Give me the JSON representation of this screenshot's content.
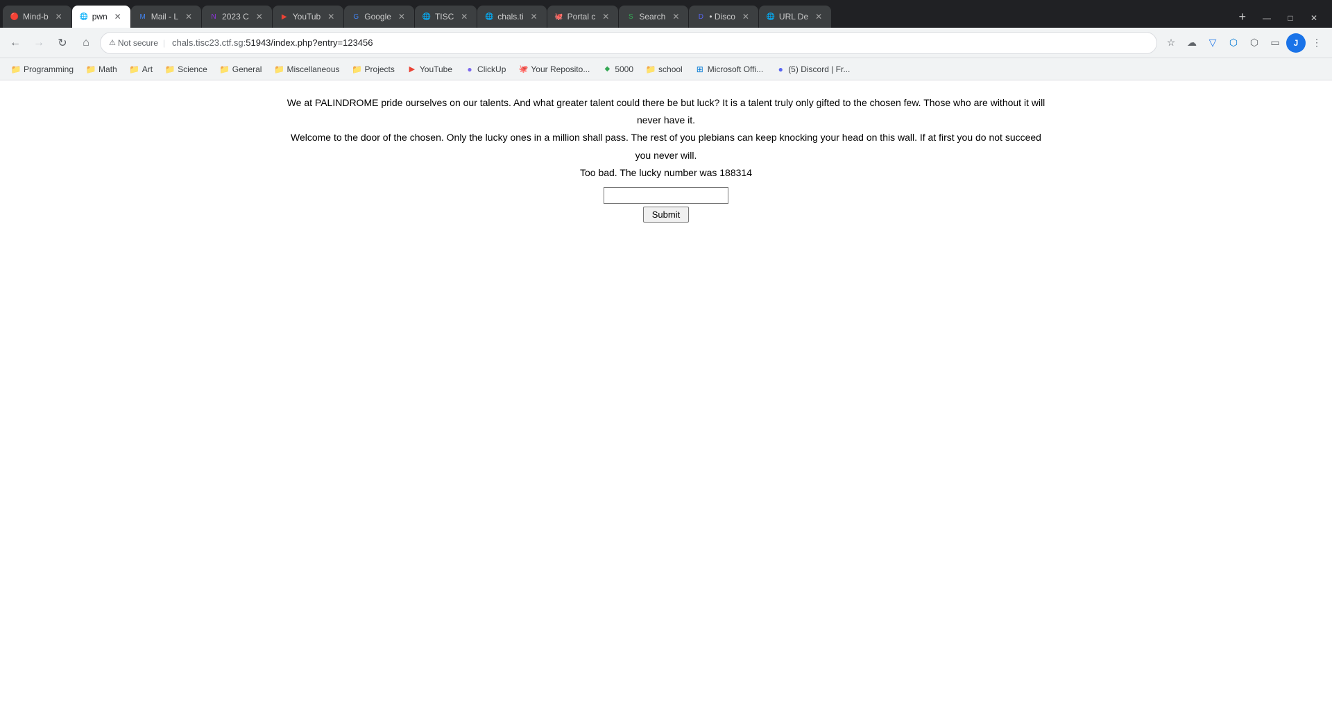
{
  "tabs": [
    {
      "id": "mind-b",
      "title": "Mind-b",
      "favicon": "🔴",
      "active": false,
      "faviconColor": "#ea4335"
    },
    {
      "id": "pwn",
      "title": "pwn",
      "favicon": "",
      "active": true,
      "faviconColor": "#fff"
    },
    {
      "id": "mail",
      "title": "Mail - L",
      "favicon": "M",
      "active": false,
      "faviconColor": "#4285f4"
    },
    {
      "id": "2023c",
      "title": "2023 C",
      "favicon": "N",
      "active": false,
      "faviconColor": "#9334e6"
    },
    {
      "id": "youtube",
      "title": "YouTub",
      "favicon": "▶",
      "active": false,
      "faviconColor": "#ea4335"
    },
    {
      "id": "google",
      "title": "Google",
      "favicon": "G",
      "active": false,
      "faviconColor": "#4285f4"
    },
    {
      "id": "tisc",
      "title": "TISC",
      "favicon": "🌐",
      "active": false,
      "faviconColor": "#5f6368"
    },
    {
      "id": "chals-ti",
      "title": "chals.ti",
      "favicon": "🌐",
      "active": false,
      "faviconColor": "#5f6368"
    },
    {
      "id": "portal",
      "title": "Portal c",
      "favicon": "🐙",
      "active": false,
      "faviconColor": "#5f6368"
    },
    {
      "id": "search",
      "title": "Search",
      "favicon": "S",
      "active": false,
      "faviconColor": "#34a853"
    },
    {
      "id": "disco",
      "title": "• Disco",
      "favicon": "D",
      "active": false,
      "faviconColor": "#5865f2"
    },
    {
      "id": "url-de",
      "title": "URL De",
      "favicon": "🌐",
      "active": false,
      "faviconColor": "#5f6368"
    }
  ],
  "address_bar": {
    "security_label": "Not secure",
    "url_prefix": "chals.tisc23.ctf.sg:",
    "url_path": "51943/index.php?entry=123456"
  },
  "bookmarks": [
    {
      "id": "programming",
      "label": "Programming",
      "type": "folder"
    },
    {
      "id": "math",
      "label": "Math",
      "type": "folder"
    },
    {
      "id": "art",
      "label": "Art",
      "type": "folder"
    },
    {
      "id": "science",
      "label": "Science",
      "type": "folder"
    },
    {
      "id": "general",
      "label": "General",
      "type": "folder"
    },
    {
      "id": "miscellaneous",
      "label": "Miscellaneous",
      "type": "folder"
    },
    {
      "id": "projects",
      "label": "Projects",
      "type": "folder"
    },
    {
      "id": "youtube-bm",
      "label": "YouTube",
      "type": "link",
      "icon": "▶"
    },
    {
      "id": "clickup",
      "label": "ClickUp",
      "type": "link",
      "icon": "CU"
    },
    {
      "id": "your-repo",
      "label": "Your Reposito...",
      "type": "link"
    },
    {
      "id": "5000",
      "label": "5000",
      "type": "link"
    },
    {
      "id": "school",
      "label": "school",
      "type": "folder"
    },
    {
      "id": "microsoft",
      "label": "Microsoft Offi...",
      "type": "link"
    },
    {
      "id": "discord-bm",
      "label": "(5) Discord | Fr...",
      "type": "link"
    }
  ],
  "page": {
    "paragraph1": "We at PALINDROME pride ourselves on our talents. And what greater talent could there be but luck? It is a talent truly only gifted to the chosen few. Those who are without it will never have it.",
    "paragraph2": "Welcome to the door of the chosen. Only the lucky ones in a million shall pass. The rest of you plebians can keep knocking your head on this wall. If at first you do not succeed you never will.",
    "paragraph3": "Too bad. The lucky number was 188314",
    "input_value": "",
    "submit_label": "Submit"
  }
}
